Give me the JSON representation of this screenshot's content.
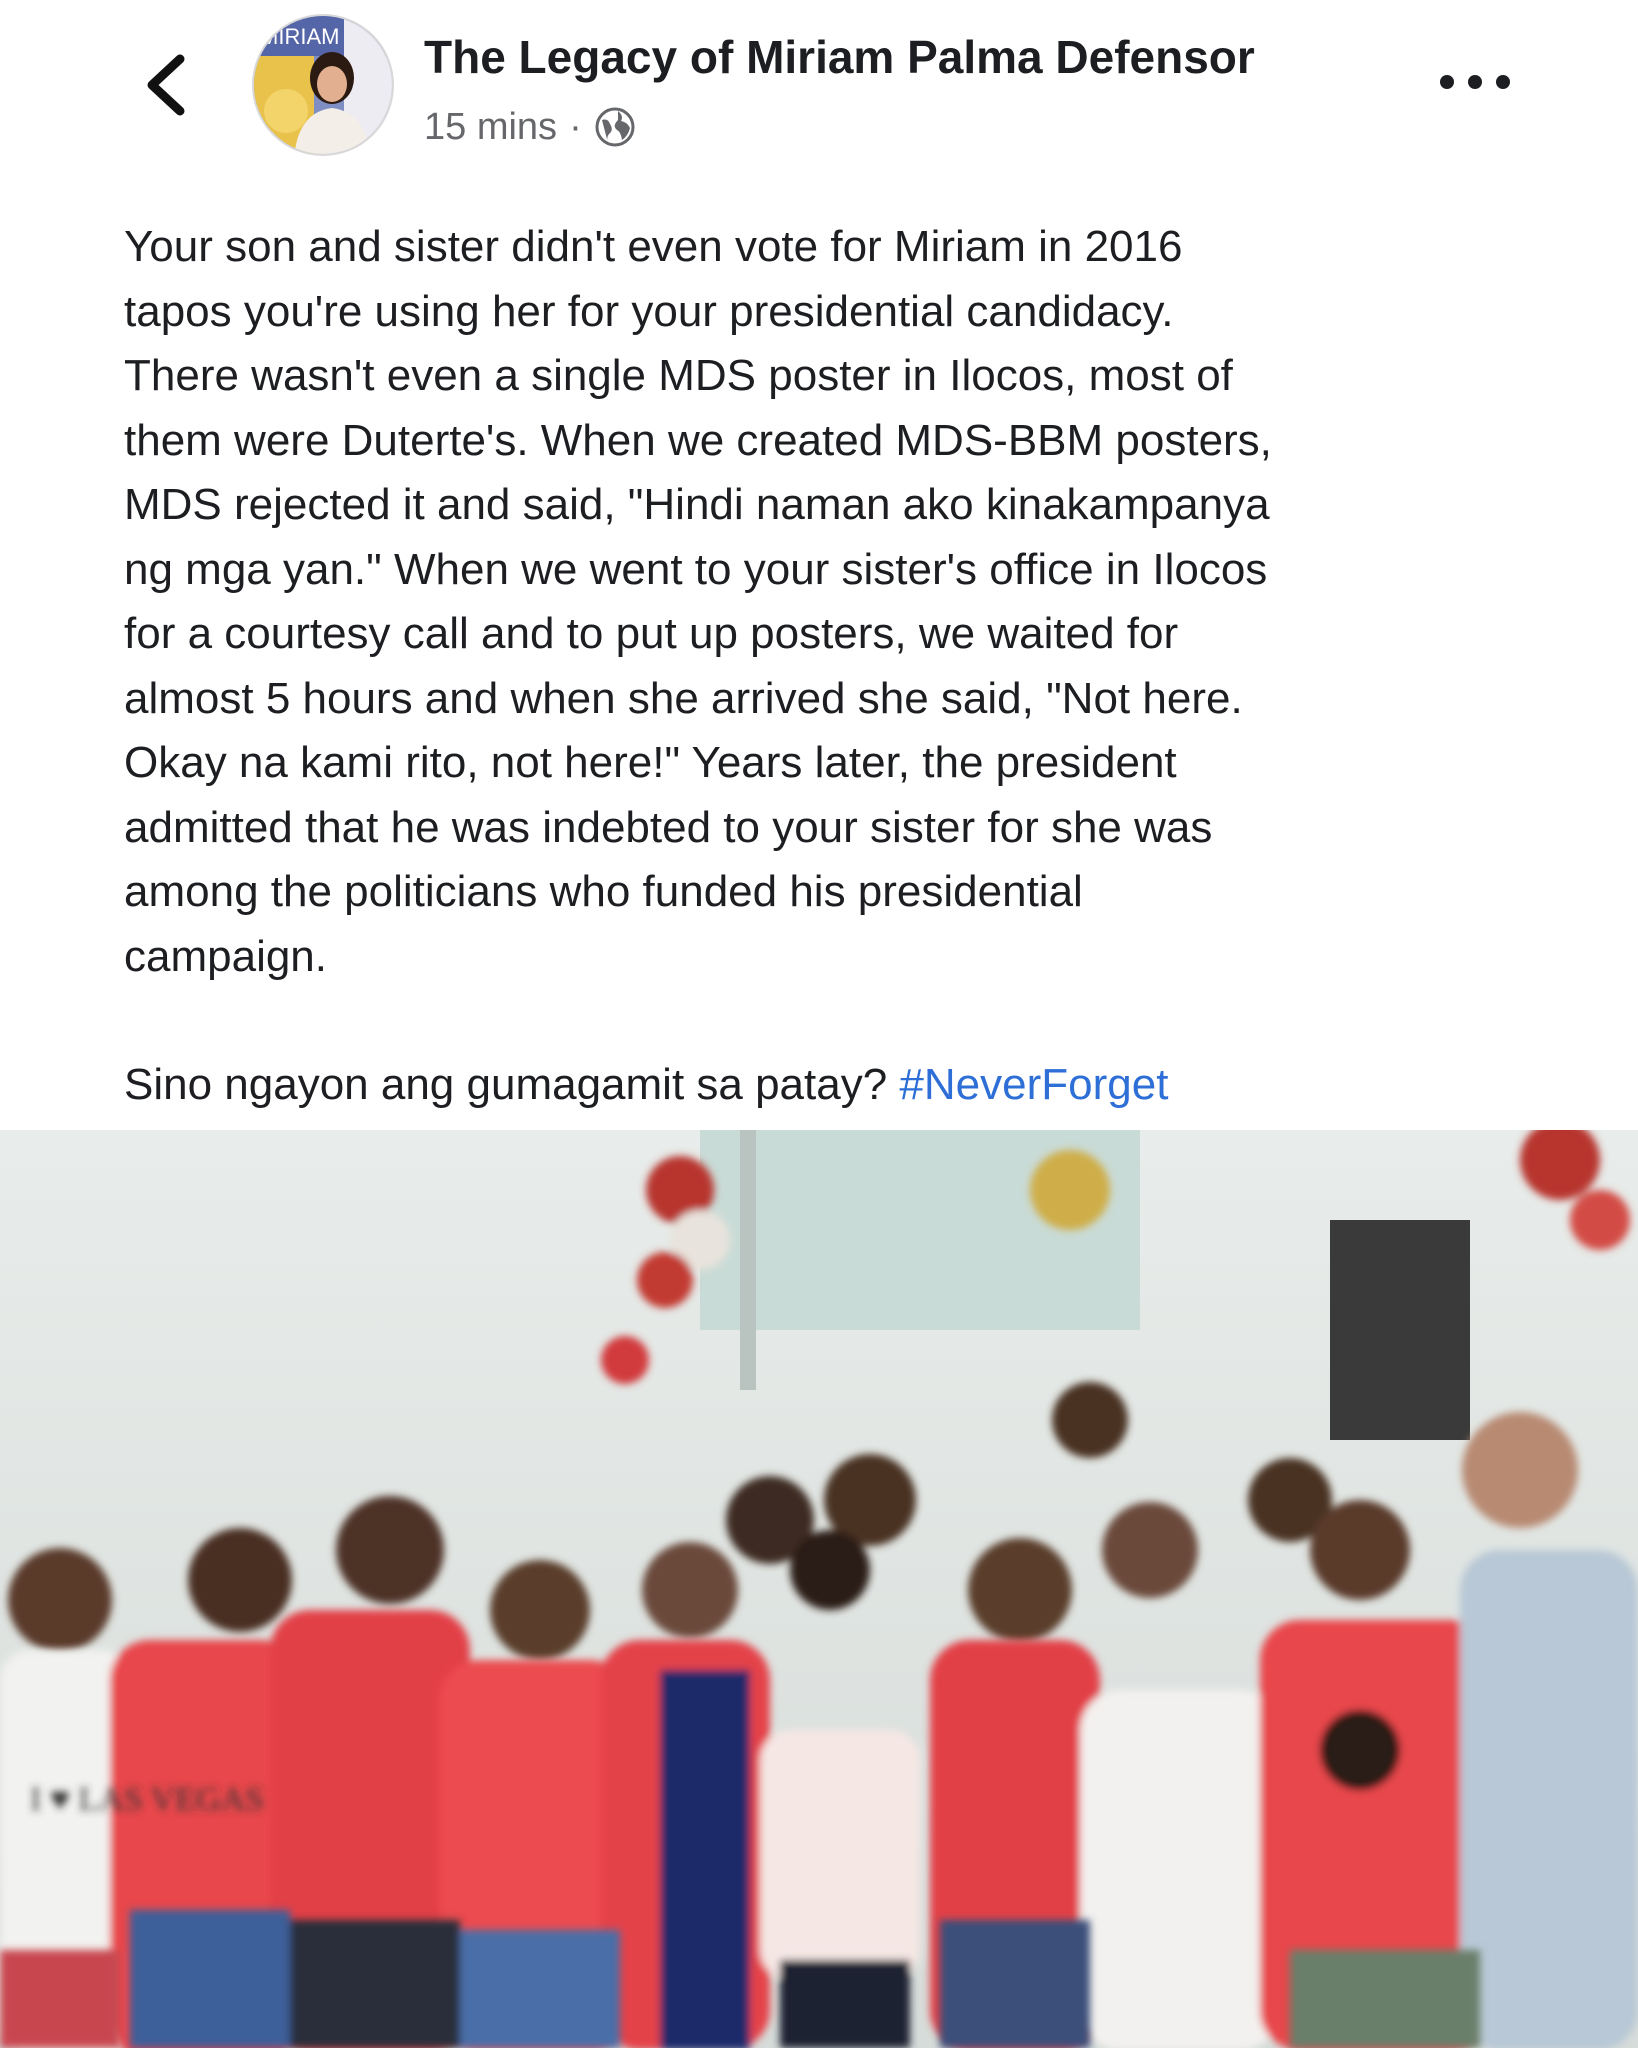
{
  "post": {
    "page_name": "The Legacy of Miriam Palma Defensor",
    "timestamp": "15 mins",
    "separator": "·",
    "audience_icon": "globe-icon",
    "avatar_text": "MIRIAM",
    "body_lines": [
      "Your son and sister didn't even vote for Miriam in 2016",
      "tapos you're using her for your presidential candidacy.",
      "There wasn't even a single MDS poster in Ilocos, most of",
      "them were Duterte's. When we created MDS-BBM posters,",
      "MDS rejected it and said, \"Hindi naman ako kinakampanya",
      "ng mga yan.\" When we went to your sister's office in Ilocos",
      "for a courtesy call and to put up posters, we waited for",
      "almost 5 hours and when she arrived she said, \"Not here.",
      "Okay na kami rito, not here!\" Years later, the president",
      "admitted that he was indebted to your sister for she was",
      "among the politicians who funded his presidential",
      "campaign."
    ],
    "closing_text": "Sino ngayon ang gumagamit sa patay? ",
    "hashtag": "#NeverForget",
    "photo_shirt_text_left": "I ♥ LAS VEGAS"
  },
  "colors": {
    "text": "#1c1e21",
    "meta": "#65676b",
    "hashtag": "#2d6fd6",
    "shirt_red": "#e8474c"
  }
}
